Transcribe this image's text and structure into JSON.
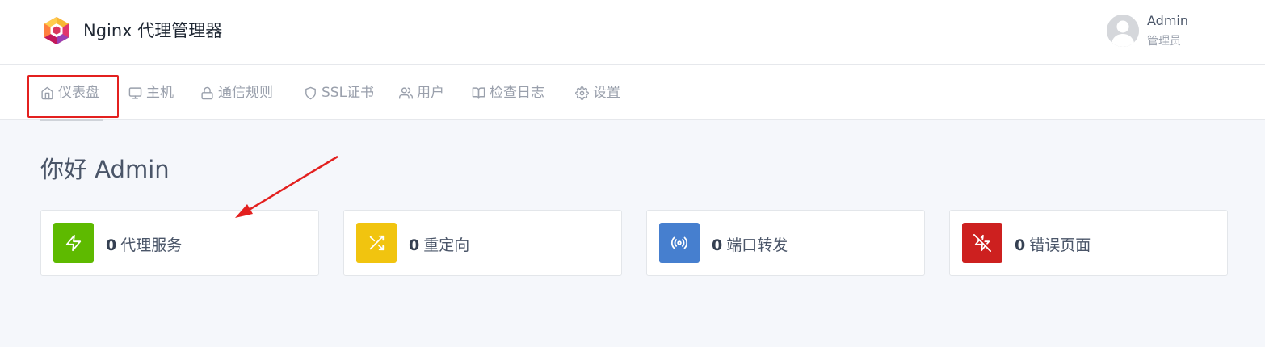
{
  "header": {
    "app_title": "Nginx 代理管理器",
    "logo_icon": "nginx-proxy-manager-logo",
    "user": {
      "name": "Admin",
      "role": "管理员",
      "avatar_icon": "user-avatar-icon"
    }
  },
  "nav": {
    "items": [
      {
        "label": "仪表盘",
        "icon": "home-icon",
        "active": true
      },
      {
        "label": "主机",
        "icon": "monitor-icon"
      },
      {
        "label": "通信规则",
        "icon": "lock-icon"
      },
      {
        "label": "SSL证书",
        "icon": "shield-icon"
      },
      {
        "label": "用户",
        "icon": "users-icon"
      },
      {
        "label": "检查日志",
        "icon": "book-icon"
      },
      {
        "label": "设置",
        "icon": "gear-icon"
      }
    ]
  },
  "main": {
    "greeting": "你好 Admin",
    "cards": [
      {
        "count": "0",
        "label": "代理服务",
        "icon": "zap-icon",
        "color": "#5eba00"
      },
      {
        "count": "0",
        "label": "重定向",
        "icon": "shuffle-icon",
        "color": "#f1c40f"
      },
      {
        "count": "0",
        "label": "端口转发",
        "icon": "radio-icon",
        "color": "#467fcf"
      },
      {
        "count": "0",
        "label": "错误页面",
        "icon": "zap-off-icon",
        "color": "#cd201f"
      }
    ]
  },
  "annotation": {
    "highlight_color": "#e3201f"
  }
}
